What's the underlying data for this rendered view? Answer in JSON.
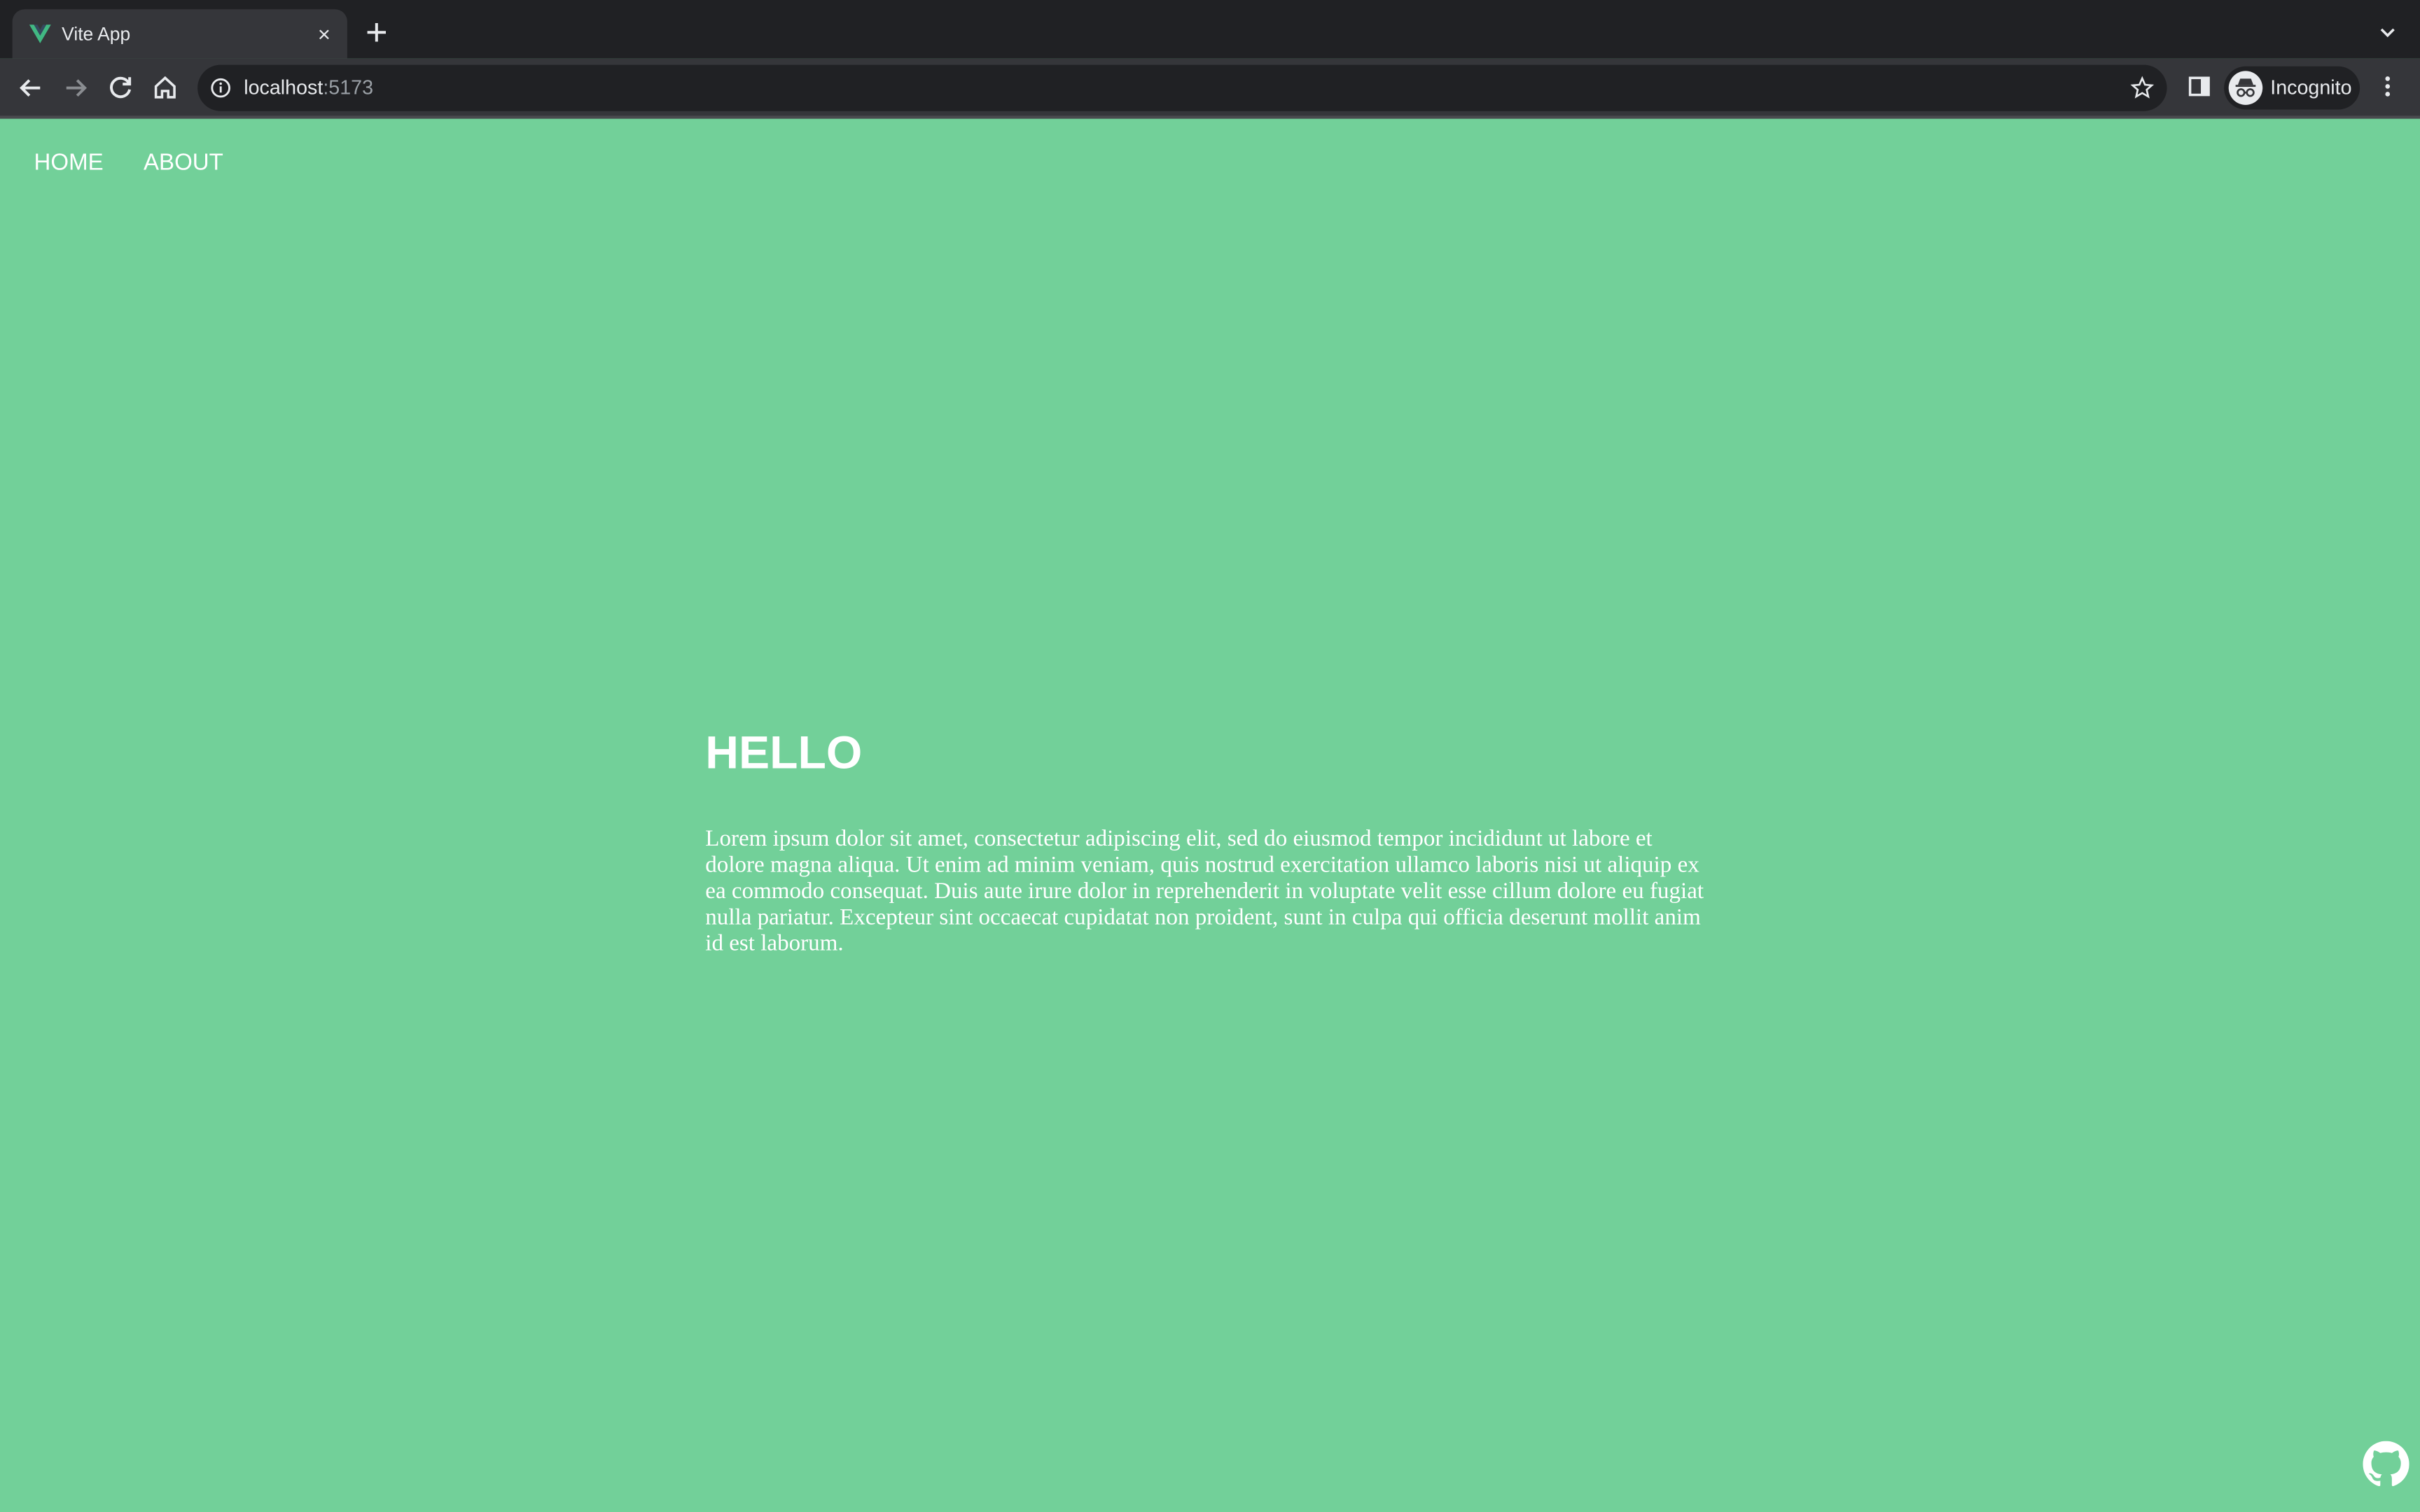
{
  "browser": {
    "tab": {
      "title": "Vite App",
      "close_symbol": "×",
      "favicon": "vue-logo-icon"
    },
    "new_tab_icon": "plus-icon",
    "tab_search_icon": "chevron-down-icon",
    "toolbar": {
      "back_icon": "arrow-left-icon",
      "forward_icon": "arrow-right-icon",
      "reload_icon": "reload-icon",
      "home_icon": "home-icon",
      "side_panel_icon": "side-panel-icon",
      "menu_icon": "kebab-menu-icon"
    },
    "omnibox": {
      "host": "localhost",
      "port": ":5173",
      "info_icon": "info-icon",
      "bookmark_icon": "star-icon"
    },
    "profile": {
      "label": "Incognito",
      "icon": "incognito-icon"
    },
    "colors": {
      "tabstrip": "#202124",
      "toolbar": "#35363a",
      "text": "#e8eaed"
    }
  },
  "site": {
    "background": "#72d099",
    "nav": {
      "home": "HOME",
      "about": "ABOUT"
    },
    "heading": "HELLO",
    "body": "Lorem ipsum dolor sit amet, consectetur adipiscing elit, sed do eiusmod tempor incididunt ut labore et dolore magna aliqua. Ut enim ad minim veniam, quis nostrud exercitation ullamco laboris nisi ut aliquip ex ea commodo consequat. Duis aute irure dolor in reprehenderit in voluptate velit esse cillum dolore eu fugiat nulla pariatur. Excepteur sint occaecat cupidatat non proident, sunt in culpa qui officia deserunt mollit anim id est laborum.",
    "github_icon": "github-icon"
  }
}
